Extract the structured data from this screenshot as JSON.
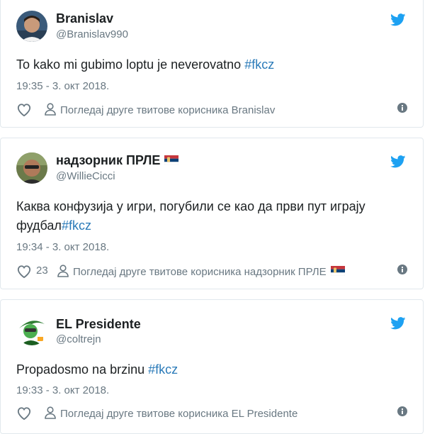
{
  "tweets": [
    {
      "name": "Branislav",
      "handle": "@Branislav990",
      "text_before": "To kako mi gubimo loptu je neverovatno ",
      "hashtag": "#fkcz",
      "timestamp": "19:35 - 3. окт 2018.",
      "likes": "",
      "profile_link": "Погледај друге твитове корисника Branislav"
    },
    {
      "name": "надзорник ПРЛЕ",
      "handle": "@WillieCicci",
      "text_before": "Каква конфузија у игри, погубили се као да први пут играју фудбал",
      "hashtag": "#fkcz",
      "timestamp": "19:34 - 3. окт 2018.",
      "likes": "23",
      "profile_link": "Погледај друге твитове корисника надзорник ПРЛЕ"
    },
    {
      "name": "EL Presidente",
      "handle": "@coltrejn",
      "text_before": "Propadosmo na brzinu ",
      "hashtag": "#fkcz",
      "timestamp": "19:33 - 3. окт 2018.",
      "likes": "",
      "profile_link": "Погледај друге твитове корисника EL Presidente"
    }
  ],
  "colors": {
    "twitter_blue": "#1da1f2",
    "hashtag": "#2b7bb9",
    "muted": "#697882"
  },
  "icons": [
    "twitter-bird-icon",
    "heart-icon",
    "person-icon",
    "info-icon",
    "serbia-flag-icon"
  ]
}
